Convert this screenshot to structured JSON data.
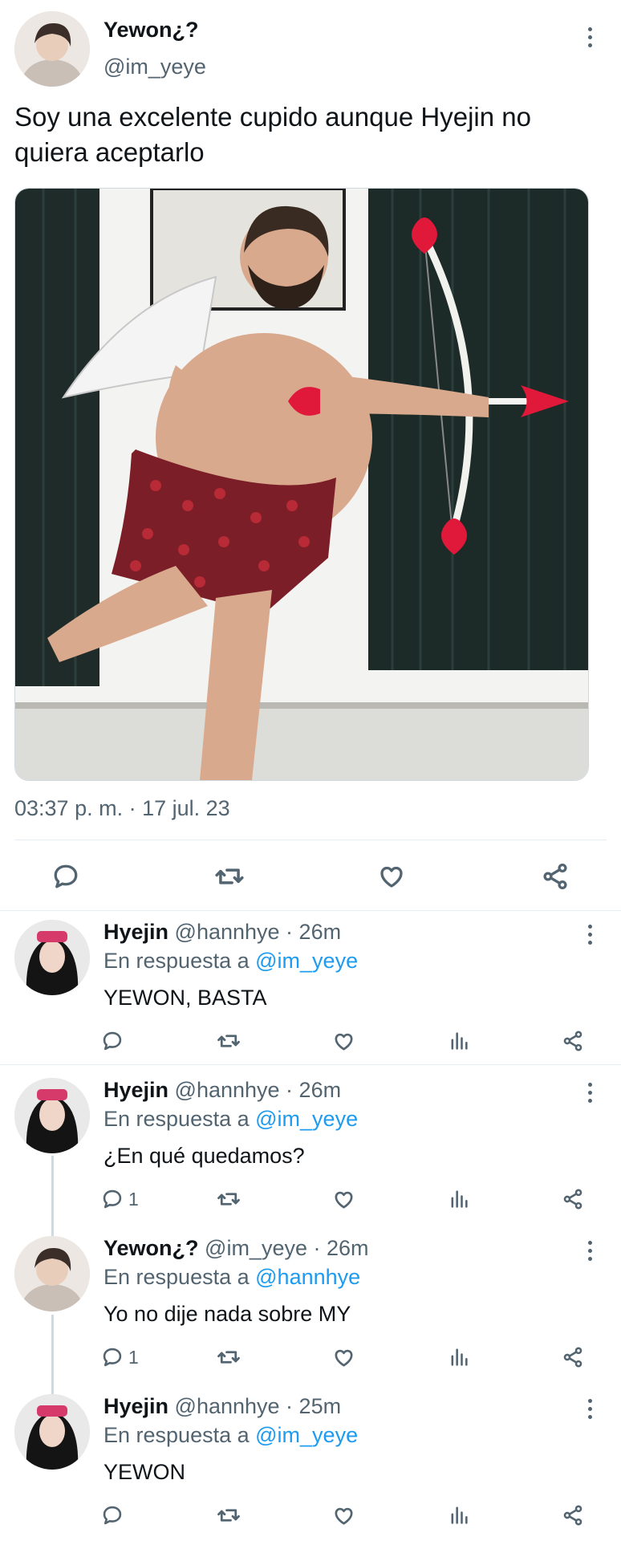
{
  "main_tweet": {
    "display_name": "Yewon¿?",
    "handle": "@im_yeye",
    "text": "Soy una excelente cupido aunque Hyejin no quiera aceptarlo",
    "timestamp": "03:37 p. m. · 17 jul. 23",
    "actions": [
      "reply-icon",
      "retweet-icon",
      "like-icon",
      "share-icon"
    ]
  },
  "replies": [
    {
      "display_name": "Hyejin",
      "meta": "@hannhye · 26m",
      "reply_prefix": "En respuesta a",
      "reply_to": "@im_yeye",
      "text": "YEWON, BASTA",
      "reply_count": ""
    },
    {
      "display_name": "Hyejin",
      "meta": "@hannhye · 26m",
      "reply_prefix": "En respuesta a",
      "reply_to": "@im_yeye",
      "text": "¿En qué quedamos?",
      "reply_count": "1"
    },
    {
      "display_name": "Yewon¿?",
      "meta": "@im_yeye · 26m",
      "reply_prefix": "En respuesta a",
      "reply_to": "@hannhye",
      "text": "Yo no dije nada sobre MY",
      "reply_count": "1"
    },
    {
      "display_name": "Hyejin",
      "meta": "@hannhye · 25m",
      "reply_prefix": "En respuesta a",
      "reply_to": "@im_yeye",
      "text": "YEWON",
      "reply_count": ""
    }
  ],
  "colors": {
    "link": "#1d9bf0",
    "muted": "#536471",
    "text": "#0f1419",
    "heart": "#e0183a"
  }
}
